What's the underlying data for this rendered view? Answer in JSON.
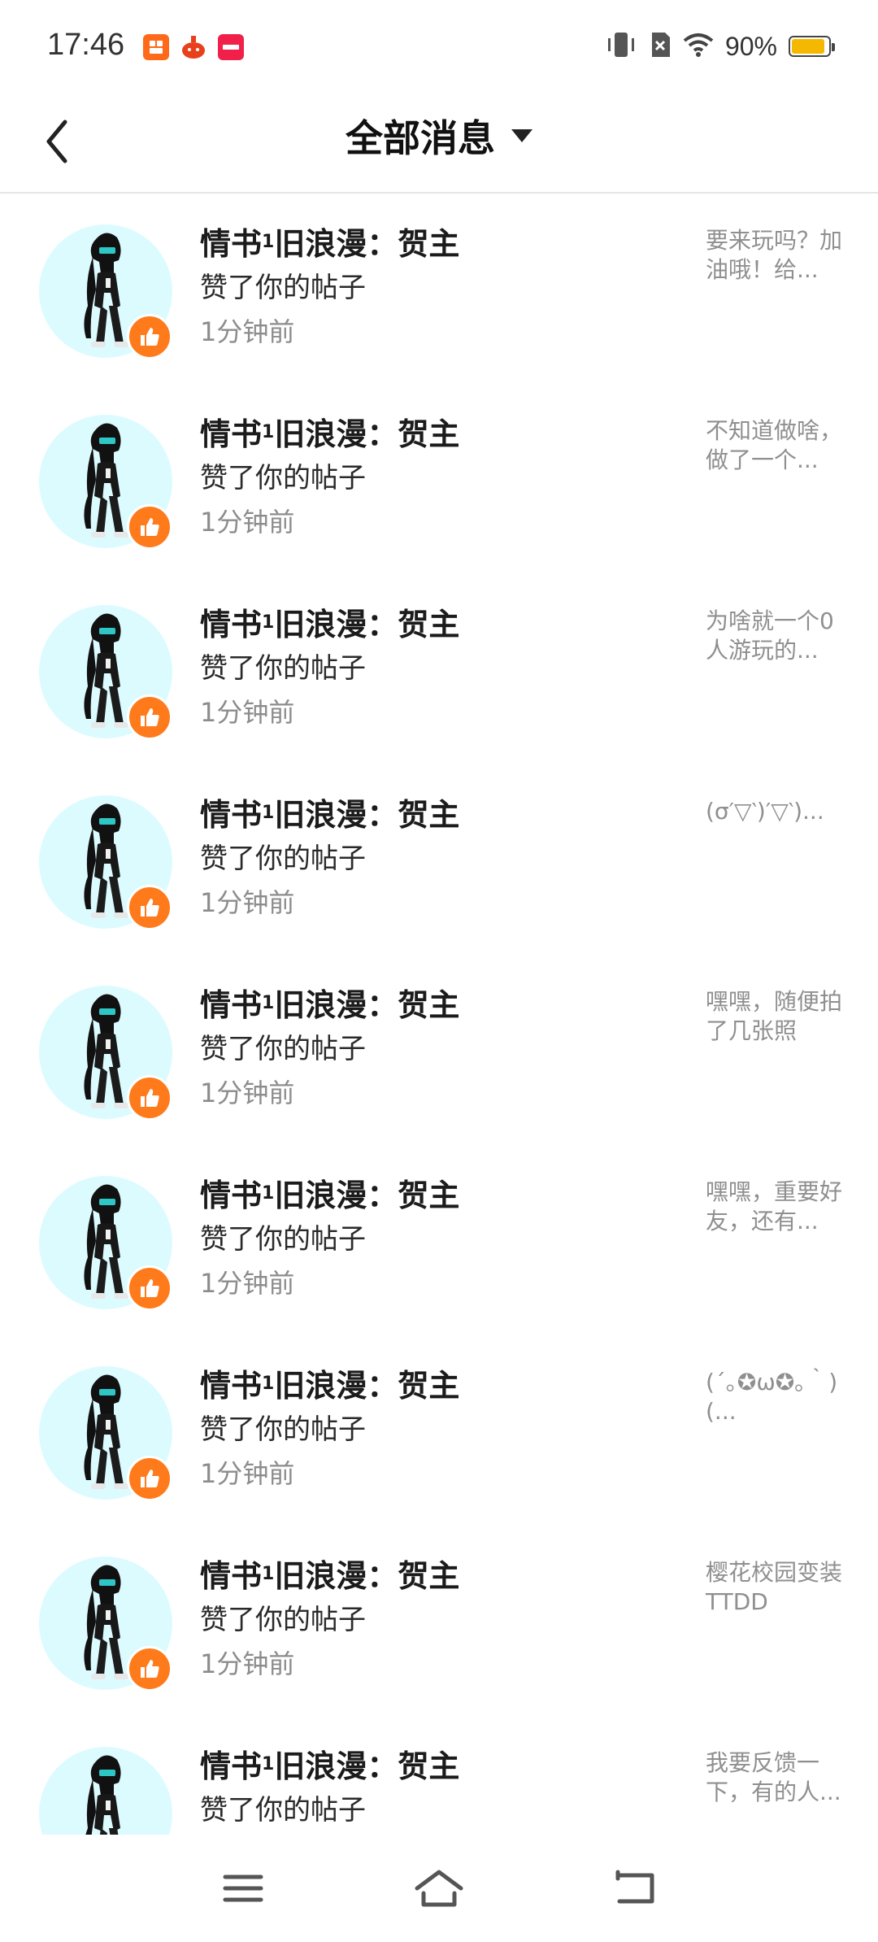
{
  "status_bar": {
    "time": "17:46",
    "battery_pct": "90%",
    "battery_level": 0.9,
    "icons": [
      "app-icon-orange",
      "app-icon-basket",
      "app-icon-red",
      "vibrate-icon",
      "sim-off-icon",
      "wifi-icon",
      "battery-icon"
    ]
  },
  "header": {
    "title": "全部消息",
    "back_icon": "chevron-left-icon",
    "dropdown_icon": "caret-down-icon"
  },
  "messages": [
    {
      "name": "情书",
      "sup": "1",
      "name_rest": "旧浪漫：贺主",
      "action": "赞了你的帖子",
      "time": "1分钟前",
      "preview": "要来玩吗？加油哦！给..."
    },
    {
      "name": "情书",
      "sup": "1",
      "name_rest": "旧浪漫：贺主",
      "action": "赞了你的帖子",
      "time": "1分钟前",
      "preview": "不知道做啥，做了一个..."
    },
    {
      "name": "情书",
      "sup": "1",
      "name_rest": "旧浪漫：贺主",
      "action": "赞了你的帖子",
      "time": "1分钟前",
      "preview": "为啥就一个0人游玩的..."
    },
    {
      "name": "情书",
      "sup": "1",
      "name_rest": "旧浪漫：贺主",
      "action": "赞了你的帖子",
      "time": "1分钟前",
      "preview": "(σ′▽‵)′▽‵)..."
    },
    {
      "name": "情书",
      "sup": "1",
      "name_rest": "旧浪漫：贺主",
      "action": "赞了你的帖子",
      "time": "1分钟前",
      "preview": "嘿嘿，随便拍了几张照"
    },
    {
      "name": "情书",
      "sup": "1",
      "name_rest": "旧浪漫：贺主",
      "action": "赞了你的帖子",
      "time": "1分钟前",
      "preview": "嘿嘿，重要好友，还有..."
    },
    {
      "name": "情书",
      "sup": "1",
      "name_rest": "旧浪漫：贺主",
      "action": "赞了你的帖子",
      "time": "1分钟前",
      "preview": "(´｡✪ω✪｡｀)(..."
    },
    {
      "name": "情书",
      "sup": "1",
      "name_rest": "旧浪漫：贺主",
      "action": "赞了你的帖子",
      "time": "1分钟前",
      "preview": "樱花校园变装TTDD"
    },
    {
      "name": "情书",
      "sup": "1",
      "name_rest": "旧浪漫：贺主",
      "action": "赞了你的帖子",
      "time": "",
      "preview": "我要反馈一下，有的人..."
    }
  ],
  "nav_bar": {
    "items": [
      "menu-icon",
      "home-icon",
      "back-icon"
    ]
  },
  "colors": {
    "accent_like": "#ff7a1a",
    "avatar_bg": "#dcfbff",
    "battery": "#f5b800",
    "muted_text": "#8c8c8c"
  }
}
